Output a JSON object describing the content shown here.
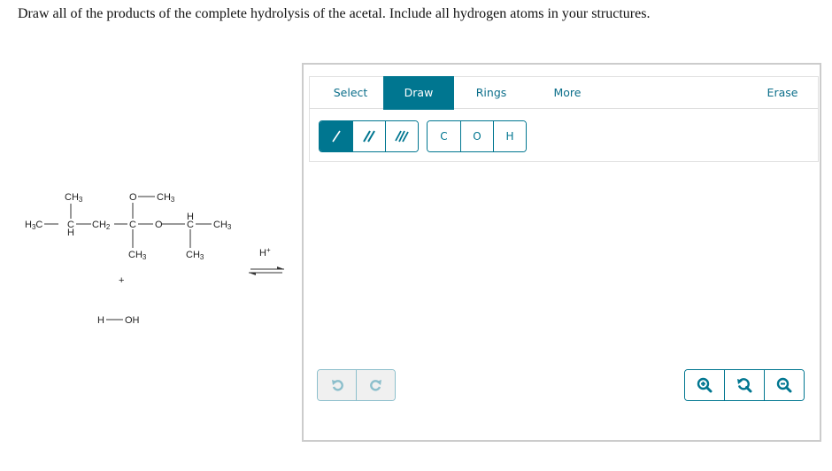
{
  "question": "Draw all of the products of the complete hydrolysis of the acetal. Include all hydrogen atoms in your structures.",
  "reaction": {
    "reactant_labels": {
      "h3c_left": "H3C",
      "ch3_top_left": "CH3",
      "c_branch": "C",
      "h_under_branch": "H",
      "ch2": "CH2",
      "c_acetal": "C",
      "o_top": "O",
      "ch3_methoxy": "CH3",
      "ch3_acetal_bottom": "CH3",
      "o_ether": "O",
      "h_isopropyl": "H",
      "c_isopropyl": "C",
      "ch3_isopropyl_right": "CH3",
      "ch3_isopropyl_bottom": "CH3"
    },
    "plus": "+",
    "water": {
      "h": "H",
      "oh": "OH"
    },
    "catalyst": "H+",
    "arrow": "equilibrium"
  },
  "editor": {
    "tabs": [
      {
        "label": "Select",
        "active": false
      },
      {
        "label": "Draw",
        "active": true
      },
      {
        "label": "Rings",
        "active": false
      },
      {
        "label": "More",
        "active": false
      }
    ],
    "erase_label": "Erase",
    "bond_tools": [
      {
        "name": "single-bond",
        "active": true
      },
      {
        "name": "double-bond",
        "active": false
      },
      {
        "name": "triple-bond",
        "active": false
      }
    ],
    "atom_tools": [
      {
        "label": "C"
      },
      {
        "label": "O"
      },
      {
        "label": "H"
      }
    ],
    "history_buttons": [
      "undo-icon",
      "redo-icon"
    ],
    "zoom_buttons": [
      "zoom-in-icon",
      "zoom-reset-icon",
      "zoom-out-icon"
    ],
    "accent_color": "#007690"
  }
}
